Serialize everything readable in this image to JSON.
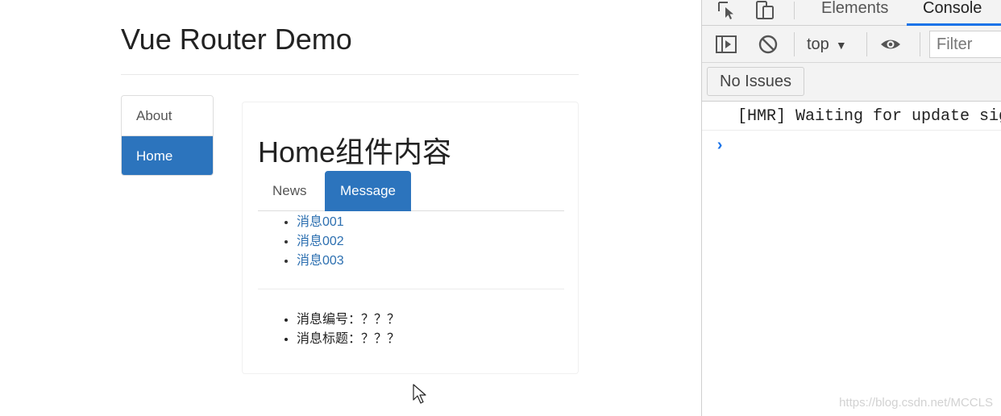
{
  "app": {
    "title": "Vue Router Demo",
    "nav": [
      {
        "label": "About",
        "active": false
      },
      {
        "label": "Home",
        "active": true
      }
    ],
    "home": {
      "title": "Home组件内容",
      "tabs": [
        {
          "label": "News",
          "active": false
        },
        {
          "label": "Message",
          "active": true
        }
      ],
      "messages": [
        "消息001",
        "消息002",
        "消息003"
      ],
      "detail": [
        "消息编号：？？？",
        "消息标题：？？？"
      ]
    }
  },
  "devtools": {
    "tabs": [
      "Elements",
      "Console"
    ],
    "active_tab": "Console",
    "context": "top",
    "filter_placeholder": "Filter",
    "issues_label": "No Issues",
    "console_lines": [
      "[HMR] Waiting for update signal from WDS..."
    ],
    "prompt": "›"
  },
  "watermark": "https://blog.csdn.net/MCCLS",
  "colors": {
    "accent": "#2c74bd",
    "link": "#2c6fb0",
    "devtools_accent": "#1a73e8"
  }
}
